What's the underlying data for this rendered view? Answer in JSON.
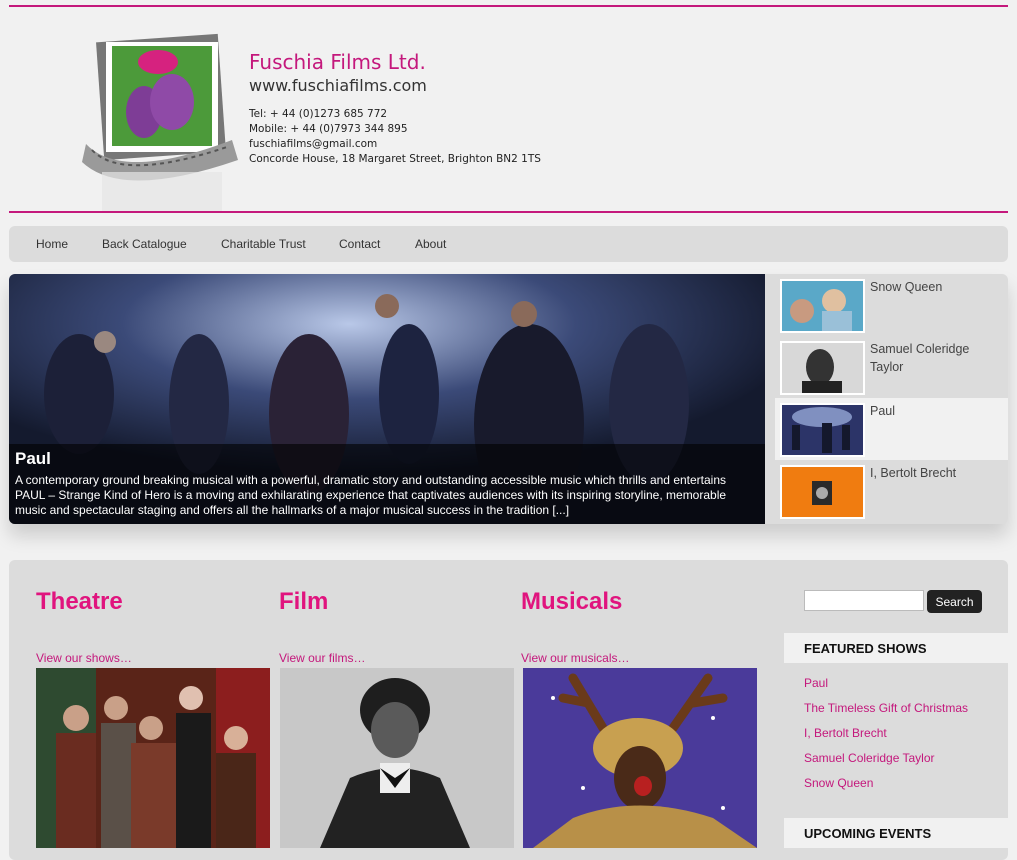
{
  "header": {
    "company": "Fuschia Films Ltd.",
    "url": "www.fuschiafilms.com",
    "tel": "Tel: + 44 (0)1273 685 772",
    "mobile": "Mobile: + 44 (0)7973 344 895",
    "email": "fuschiafilms@gmail.com",
    "address": "Concorde House, 18 Margaret Street, Brighton BN2 1TS"
  },
  "nav": {
    "items": [
      "Home",
      "Back Catalogue",
      "Charitable Trust",
      "Contact",
      "About"
    ]
  },
  "slider": {
    "title": "Paul",
    "description": "A contemporary ground breaking musical with a powerful, dramatic story and outstanding accessible music which thrills and entertains PAUL – Strange Kind of Hero is a moving and exhilarating experience that captivates audiences with its inspiring storyline, memorable music and spectacular staging and offers all the hallmarks of a major musical success in the tradition [...]",
    "thumbs": [
      "Snow Queen",
      "Samuel Coleridge Taylor",
      "Paul",
      "I, Bertolt Brecht"
    ],
    "active_index": 2
  },
  "categories": [
    {
      "title": "Theatre",
      "link": "View our shows…"
    },
    {
      "title": "Film",
      "link": "View our films…"
    },
    {
      "title": "Musicals",
      "link": "View our musicals…"
    }
  ],
  "sidebar": {
    "search_button": "Search",
    "featured_heading": "FEATURED SHOWS",
    "featured": [
      "Paul",
      "The Timeless Gift of Christmas",
      "I, Bertolt Brecht",
      "Samuel Coleridge Taylor",
      "Snow Queen"
    ],
    "upcoming_heading": "UPCOMING EVENTS"
  },
  "colors": {
    "accent": "#c4187c",
    "heading": "#e0147e",
    "panel": "#dcdcdc",
    "background": "#f1f1f1"
  }
}
